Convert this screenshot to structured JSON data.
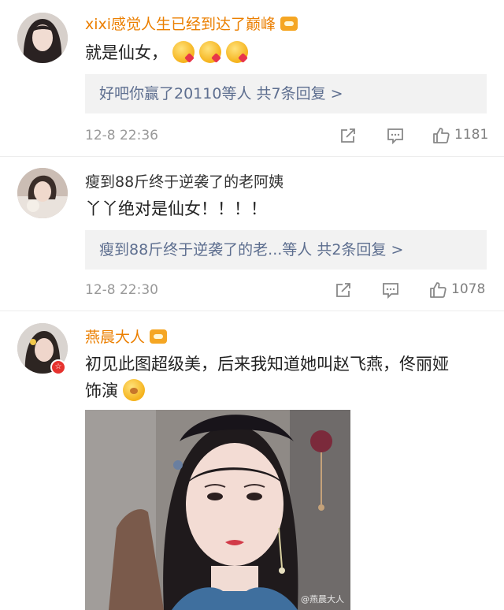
{
  "comments": [
    {
      "username": "xixi感觉人生已经到达了巅峰",
      "username_color": "#eb7f00",
      "text": "就是仙女，",
      "emojis": [
        "kiss-emoji",
        "kiss-emoji",
        "kiss-emoji"
      ],
      "replies": "好吧你赢了20110等人  共7条回复 >",
      "time": "12-8 22:36",
      "likes": "1181"
    },
    {
      "username": "瘦到88斤终于逆袭了的老阿姨",
      "username_color": "#333333",
      "text": "丫丫绝对是仙女！！！！",
      "replies": "瘦到88斤终于逆袭了的老...等人  共2条回复 >",
      "time": "12-8 22:30",
      "likes": "1078"
    },
    {
      "username": "燕晨大人",
      "username_color": "#eb7f00",
      "text_line1": "初见此图超级美，后来我知道她叫赵飞燕，佟丽娅",
      "text_line2": "饰演",
      "emojis": [
        "shy-emoji"
      ],
      "watermark": "@燕晨大人"
    }
  ],
  "icons": [
    "share-icon",
    "comment-icon",
    "like-icon"
  ]
}
